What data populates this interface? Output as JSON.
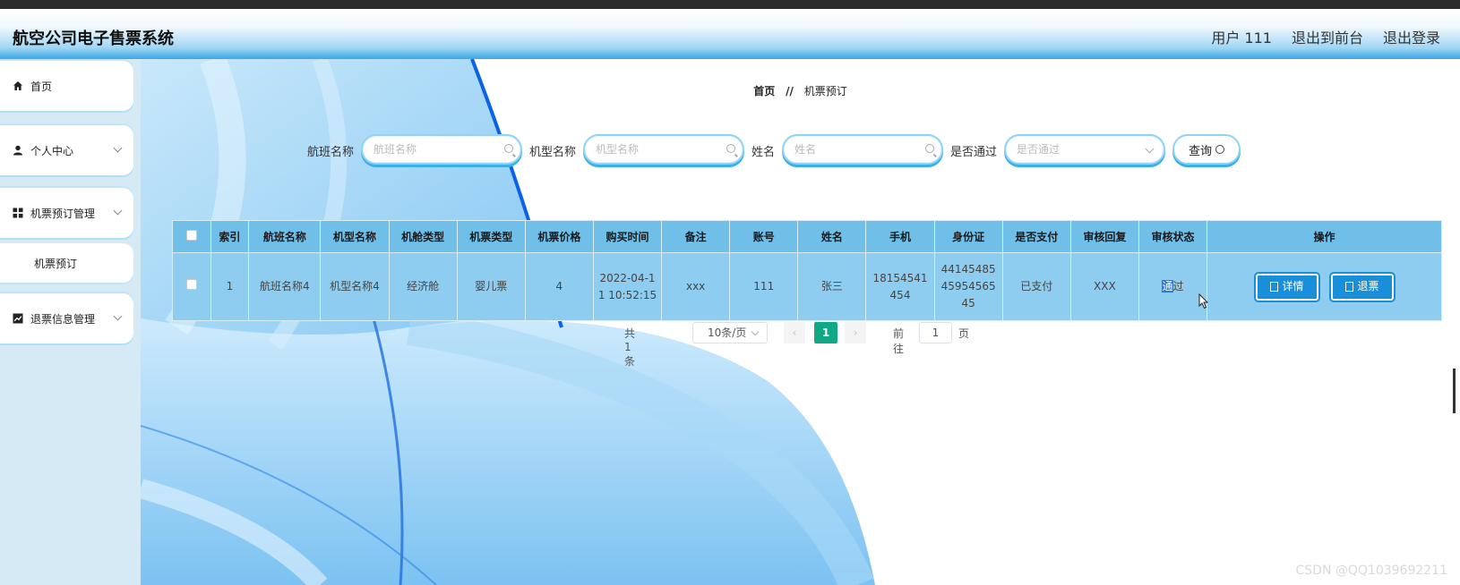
{
  "header": {
    "app_title": "航空公司电子售票系统",
    "user_label": "用户 111",
    "frontend_link": "退出到前台",
    "logout_link": "退出登录"
  },
  "sidebar": {
    "items": [
      {
        "label": "首页",
        "icon": "home-icon"
      },
      {
        "label": "个人中心",
        "icon": "user-icon"
      },
      {
        "label": "机票预订管理",
        "icon": "grid-icon"
      },
      {
        "label": "机票预订",
        "icon": ""
      },
      {
        "label": "退票信息管理",
        "icon": "chart-icon"
      }
    ]
  },
  "breadcrumb": {
    "home": "首页",
    "separator": "//",
    "current": "机票预订"
  },
  "search": {
    "flight_label": "航班名称",
    "flight_placeholder": "航班名称",
    "model_label": "机型名称",
    "model_placeholder": "机型名称",
    "name_label": "姓名",
    "name_placeholder": "姓名",
    "passed_label": "是否通过",
    "passed_placeholder": "是否通过",
    "query_button": "查询"
  },
  "table": {
    "headers": [
      "索引",
      "航班名称",
      "机型名称",
      "机舱类型",
      "机票类型",
      "机票价格",
      "购买时间",
      "备注",
      "账号",
      "姓名",
      "手机",
      "身份证",
      "是否支付",
      "审核回复",
      "审核状态",
      "操作"
    ],
    "rows": [
      {
        "index": "1",
        "flight": "航班名称4",
        "model": "机型名称4",
        "cabin": "经济舱",
        "ticket_type": "婴儿票",
        "price": "4",
        "time": "2022-04-11 10:52:15",
        "remark": "xxx",
        "account": "111",
        "name": "张三",
        "phone": "18154541454",
        "id_card": "441454854595456545",
        "paid": "已支付",
        "reply": "XXX",
        "status_hl": "通",
        "status_rest": "过",
        "detail_button": "详情",
        "refund_button": "退票"
      }
    ]
  },
  "pager": {
    "total": "共 1 条",
    "page_size": "10条/页",
    "current_page": "1",
    "goto_label": "前往",
    "goto_value": "1",
    "page_unit": "页"
  },
  "watermark": "CSDN @QQ1039692211",
  "colors": {
    "header_gradient_end": "#3aa7e6",
    "table_header": "#6fbfe9",
    "table_row": "#8ecdf0",
    "action_button": "#1a8fd9",
    "active_page": "#11a885"
  }
}
